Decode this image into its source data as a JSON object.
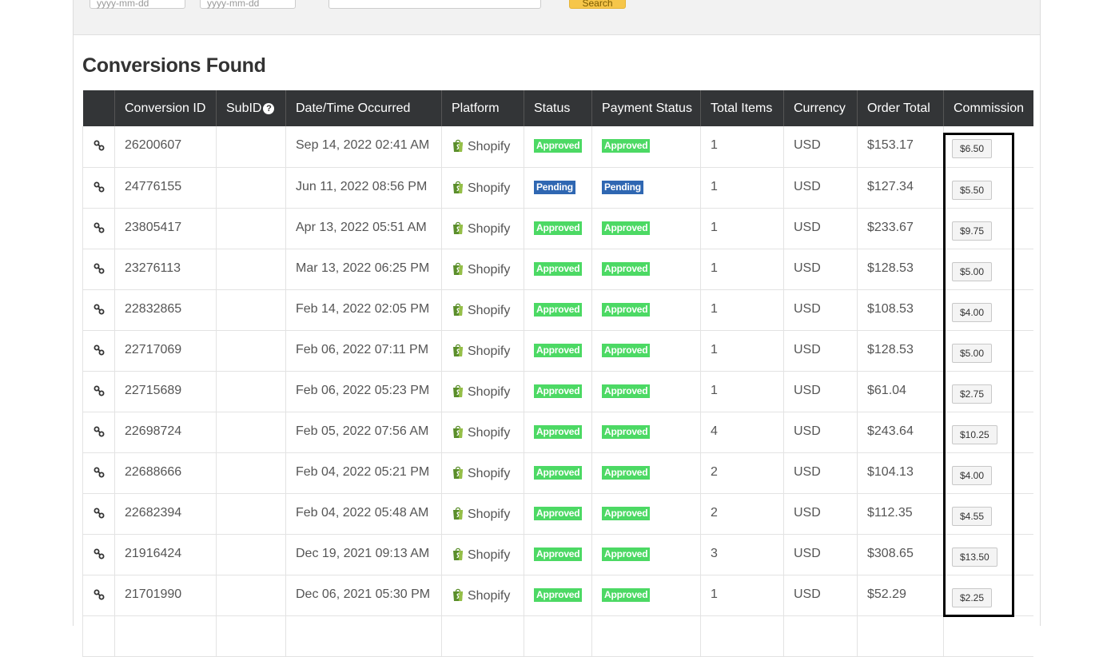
{
  "filters": {
    "date_from_placeholder": "yyyy-mm-dd",
    "date_to_placeholder": "yyyy-mm-dd",
    "search_label": "Search"
  },
  "heading": "Conversions Found",
  "columns": [
    "",
    "Conversion ID",
    "SubID",
    "Date/Time Occurred",
    "Platform",
    "Status",
    "Payment Status",
    "Total Items",
    "Currency",
    "Order Total",
    "Commission"
  ],
  "rows": [
    {
      "id": "26200607",
      "subid": "",
      "date": "Sep 14, 2022 02:41 AM",
      "platform": "Shopify",
      "status": "Approved",
      "payment": "Approved",
      "items": "1",
      "currency": "USD",
      "total": "$153.17",
      "commission": "$6.50"
    },
    {
      "id": "24776155",
      "subid": "",
      "date": "Jun 11, 2022 08:56 PM",
      "platform": "Shopify",
      "status": "Pending",
      "payment": "Pending",
      "items": "1",
      "currency": "USD",
      "total": "$127.34",
      "commission": "$5.50"
    },
    {
      "id": "23805417",
      "subid": "",
      "date": "Apr 13, 2022 05:51 AM",
      "platform": "Shopify",
      "status": "Approved",
      "payment": "Approved",
      "items": "1",
      "currency": "USD",
      "total": "$233.67",
      "commission": "$9.75"
    },
    {
      "id": "23276113",
      "subid": "",
      "date": "Mar 13, 2022 06:25 PM",
      "platform": "Shopify",
      "status": "Approved",
      "payment": "Approved",
      "items": "1",
      "currency": "USD",
      "total": "$128.53",
      "commission": "$5.00"
    },
    {
      "id": "22832865",
      "subid": "",
      "date": "Feb 14, 2022 02:05 PM",
      "platform": "Shopify",
      "status": "Approved",
      "payment": "Approved",
      "items": "1",
      "currency": "USD",
      "total": "$108.53",
      "commission": "$4.00"
    },
    {
      "id": "22717069",
      "subid": "",
      "date": "Feb 06, 2022 07:11 PM",
      "platform": "Shopify",
      "status": "Approved",
      "payment": "Approved",
      "items": "1",
      "currency": "USD",
      "total": "$128.53",
      "commission": "$5.00"
    },
    {
      "id": "22715689",
      "subid": "",
      "date": "Feb 06, 2022 05:23 PM",
      "platform": "Shopify",
      "status": "Approved",
      "payment": "Approved",
      "items": "1",
      "currency": "USD",
      "total": "$61.04",
      "commission": "$2.75"
    },
    {
      "id": "22698724",
      "subid": "",
      "date": "Feb 05, 2022 07:56 AM",
      "platform": "Shopify",
      "status": "Approved",
      "payment": "Approved",
      "items": "4",
      "currency": "USD",
      "total": "$243.64",
      "commission": "$10.25"
    },
    {
      "id": "22688666",
      "subid": "",
      "date": "Feb 04, 2022 05:21 PM",
      "platform": "Shopify",
      "status": "Approved",
      "payment": "Approved",
      "items": "2",
      "currency": "USD",
      "total": "$104.13",
      "commission": "$4.00"
    },
    {
      "id": "22682394",
      "subid": "",
      "date": "Feb 04, 2022 05:48 AM",
      "platform": "Shopify",
      "status": "Approved",
      "payment": "Approved",
      "items": "2",
      "currency": "USD",
      "total": "$112.35",
      "commission": "$4.55"
    },
    {
      "id": "21916424",
      "subid": "",
      "date": "Dec 19, 2021 09:13 AM",
      "platform": "Shopify",
      "status": "Approved",
      "payment": "Approved",
      "items": "3",
      "currency": "USD",
      "total": "$308.65",
      "commission": "$13.50"
    },
    {
      "id": "21701990",
      "subid": "",
      "date": "Dec 06, 2021 05:30 PM",
      "platform": "Shopify",
      "status": "Approved",
      "payment": "Approved",
      "items": "1",
      "currency": "USD",
      "total": "$52.29",
      "commission": "$2.25"
    },
    {
      "id": "",
      "subid": "",
      "date": "",
      "platform": "",
      "status": "",
      "payment": "",
      "items": "",
      "currency": "",
      "total": "",
      "commission": ""
    }
  ],
  "colors": {
    "header_bg": "#333537",
    "approved": "#4cd964",
    "pending": "#2f67b2",
    "search_button": "#f6c64a"
  },
  "icons": {
    "row_link": "link-icon",
    "subid_help": "help-icon",
    "platform": "shopify-bag-icon"
  }
}
